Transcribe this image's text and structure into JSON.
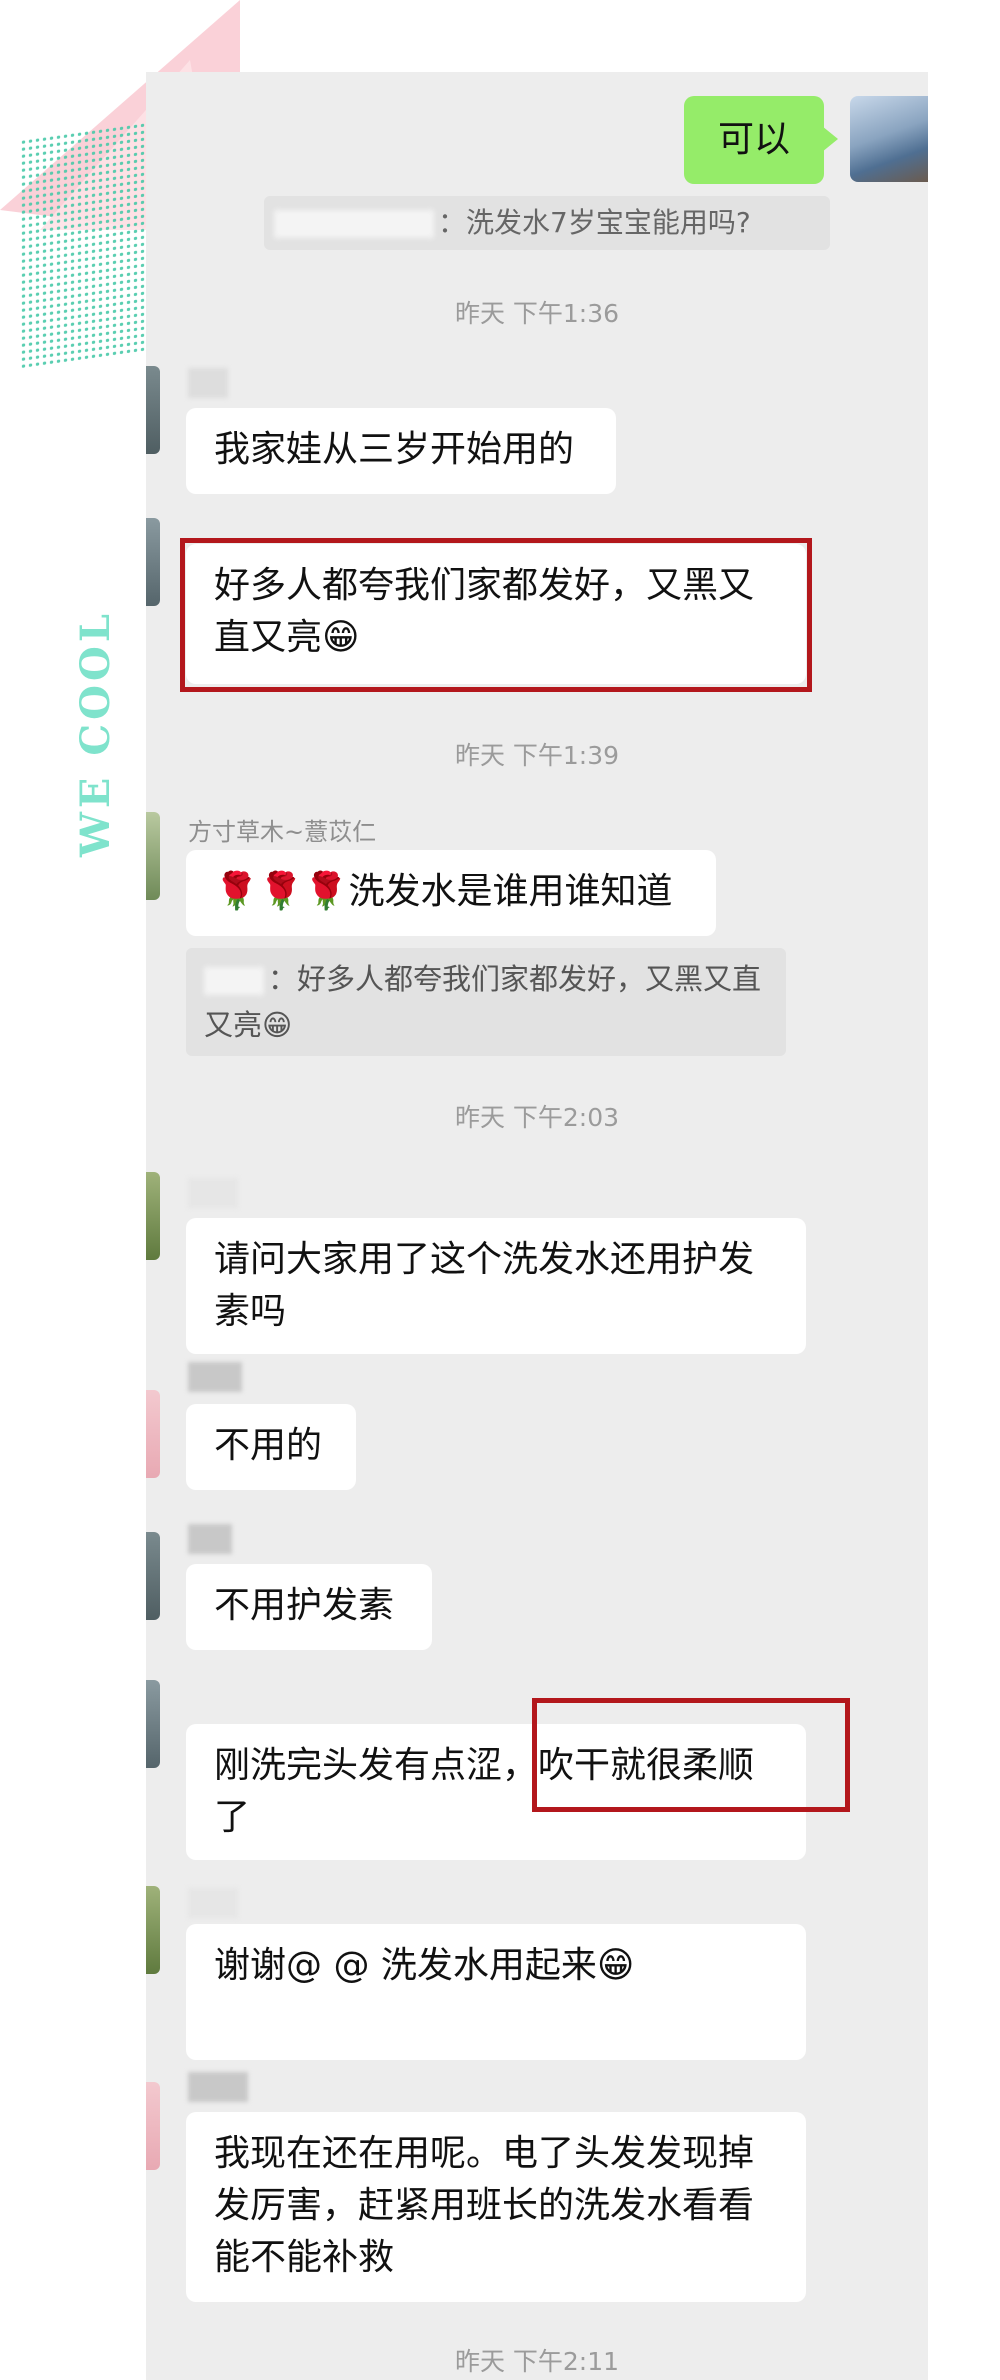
{
  "decoration": {
    "vertical_text": "WE COOL"
  },
  "self_message": {
    "text": "可以"
  },
  "quote1": {
    "text": "：洗发水7岁宝宝能用吗?"
  },
  "times": [
    "昨天 下午1:36",
    "昨天 下午1:39",
    "昨天 下午2:03",
    "昨天 下午2:11"
  ],
  "messages": [
    {
      "sender": "",
      "text": "我家娃从三岁开始用的"
    },
    {
      "sender": "",
      "text": "好多人都夸我们家都发好，又黑又直又亮😁"
    },
    {
      "sender": "方寸草木~薏苡仁",
      "text": "🌹🌹🌹洗发水是谁用谁知道"
    },
    {
      "sender": "",
      "text": "请问大家用了这个洗发水还用护发素吗"
    },
    {
      "sender": "",
      "text": "不用的"
    },
    {
      "sender": "",
      "text": "不用护发素"
    },
    {
      "sender": "",
      "text": "刚洗完头发有点涩，吹干就很柔顺了"
    },
    {
      "sender": "",
      "text": "谢谢@ @ 洗发水用起来😁"
    },
    {
      "sender": "",
      "text": "我现在还在用呢。电了头发发现掉发厉害，赶紧用班长的洗发水看看能不能补救"
    }
  ],
  "quote2": {
    "text": "：好多人都夸我们家都发好，又黑又直又亮😁"
  },
  "colors": {
    "highlight": "#b3171c",
    "self_bubble": "#95ec69",
    "chat_bg": "#ededed"
  }
}
